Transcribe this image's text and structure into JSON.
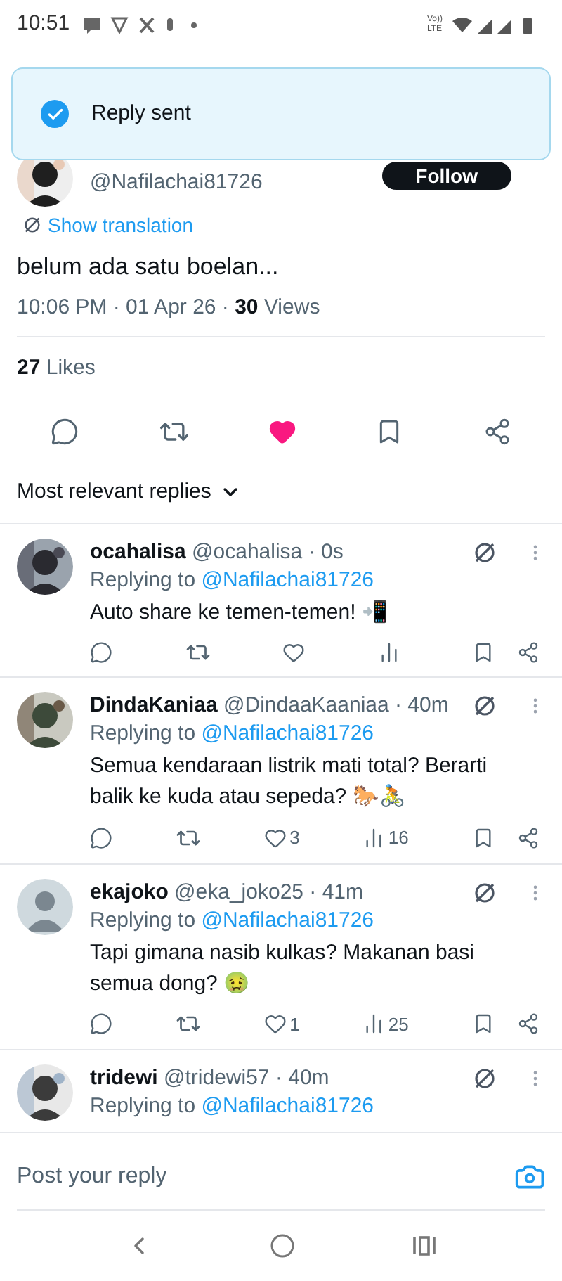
{
  "status_bar": {
    "time": "10:51",
    "network": "Vo)) LTE"
  },
  "toast": {
    "text": "Reply sent"
  },
  "tweet": {
    "handle": "@Nafilachai81726",
    "follow": "Follow",
    "translate": "Show translation",
    "text": "belum ada satu boelan...",
    "time": "10:06 PM · 01 Apr 26 · ",
    "views_count": "30",
    "views_label": " Views",
    "likes_count": "27",
    "likes_label": " Likes",
    "liked": true,
    "bookmarked": false
  },
  "sort": {
    "label": "Most relevant replies"
  },
  "replies": [
    {
      "name": "ocahalisa",
      "handle": "@ocahalisa · 0s",
      "replying_label": "Replying to ",
      "replying_to": "@Nafilachai81726",
      "text": "Auto share ke temen-temen! 📲",
      "liked": false
    },
    {
      "name": "DindaKaniaa",
      "handle": "@DindaaKaaniaa · 40m",
      "replying_label": "Replying to ",
      "replying_to": "@Nafilachai81726",
      "text": "Semua kendaraan listrik mati total? Berarti balik ke kuda atau sepeda? 🐎🚴",
      "likes": "3",
      "views": "16",
      "liked": false
    },
    {
      "name": "ekajoko",
      "handle": "@eka_joko25 · 41m",
      "replying_label": "Replying to ",
      "replying_to": "@Nafilachai81726",
      "text": "Tapi gimana nasib kulkas? Makanan basi semua dong? 🤢",
      "likes": "1",
      "views": "25",
      "liked": false,
      "kind": "default"
    },
    {
      "name": "tridewi",
      "handle": "@tridewi57 · 40m",
      "replying_label": "Replying to ",
      "replying_to": "@Nafilachai81726"
    }
  ],
  "reply_bar": {
    "placeholder": "Post your reply"
  }
}
